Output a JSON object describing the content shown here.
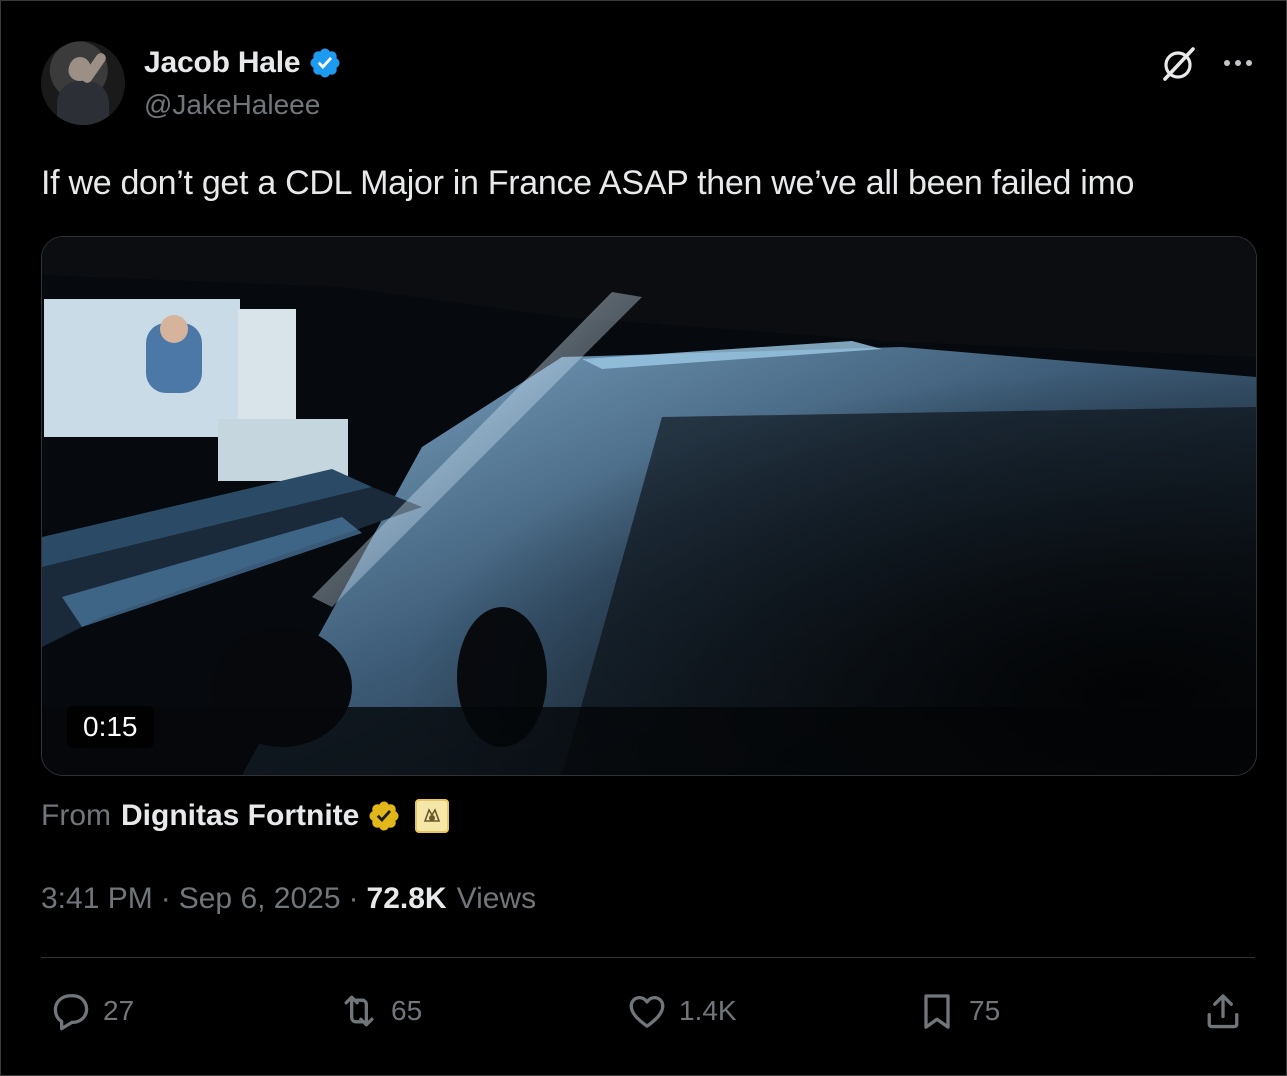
{
  "author": {
    "display_name": "Jacob Hale",
    "handle": "@JakeHaleee",
    "verified_badge_color": "#1d9bf0"
  },
  "header_icons": {
    "grok": "grok-icon",
    "more": "more-icon"
  },
  "tweet": {
    "text": "If we don’t get a CDL Major in France ASAP then we’ve all been failed imo"
  },
  "media": {
    "type": "video",
    "duration": "0:15"
  },
  "source": {
    "prefix": "From",
    "name": "Dignitas Fortnite",
    "badge_color": "#e2b719"
  },
  "meta": {
    "time": "3:41 PM",
    "date": "Sep 6, 2025",
    "views_count": "72.8K",
    "views_label": "Views"
  },
  "actions": {
    "replies": "27",
    "reposts": "65",
    "likes": "1.4K",
    "bookmarks": "75"
  },
  "colors": {
    "background": "#000000",
    "text_primary": "#e7e9ea",
    "text_secondary": "#71767b",
    "divider": "#2f3336"
  }
}
